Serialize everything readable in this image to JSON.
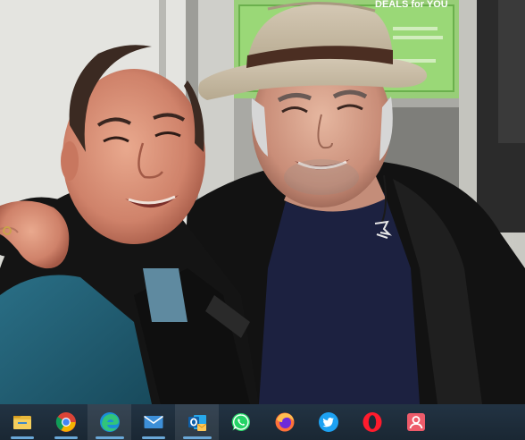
{
  "poster": {
    "headline": "DEALS for YOU"
  },
  "taskbar": {
    "background": "#1c2b38",
    "indicator_color": "#6aa8d8",
    "items": [
      {
        "icon": "file-explorer-icon",
        "state": "running"
      },
      {
        "icon": "chrome-icon",
        "state": "running"
      },
      {
        "icon": "edge-icon",
        "state": "active"
      },
      {
        "icon": "mail-icon",
        "state": "running"
      },
      {
        "icon": "outlook-icon",
        "state": "active"
      },
      {
        "icon": "whatsapp-icon",
        "state": "none"
      },
      {
        "icon": "firefox-icon",
        "state": "none"
      },
      {
        "icon": "twitter-icon",
        "state": "none"
      },
      {
        "icon": "opera-icon",
        "state": "none"
      },
      {
        "icon": "people-app-icon",
        "state": "none"
      }
    ]
  }
}
